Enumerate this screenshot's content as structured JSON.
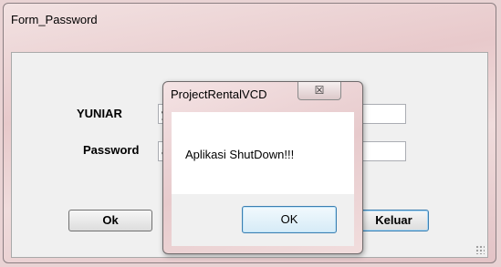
{
  "main_window": {
    "title": "Form_Password",
    "username_label": "YUNIAR",
    "username_value": "y",
    "password_label": "Password",
    "password_value": "a",
    "ok_label": "Ok",
    "exit_label": "Keluar"
  },
  "message_box": {
    "title": "ProjectRentalVCD",
    "close_glyph": "☒",
    "message": "Aplikasi ShutDown!!!",
    "ok_label": "OK"
  }
}
